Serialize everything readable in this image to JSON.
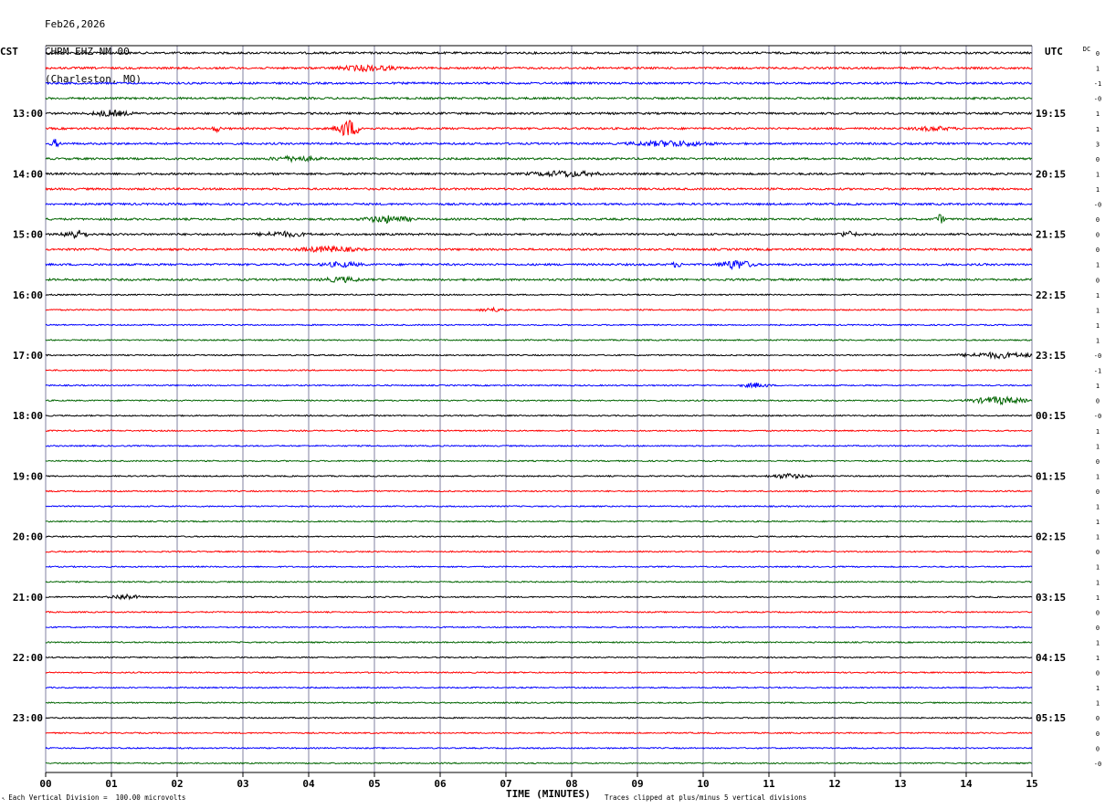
{
  "header": {
    "date": "Feb26,2026",
    "station": "CHRM EHZ NM 00",
    "location": "(Charleston, MO)"
  },
  "left_zone": "CST",
  "right_zone": "UTC",
  "dc_header": "DC",
  "colors": {
    "trace_cycle": [
      "#000000",
      "#ff0000",
      "#0000ff",
      "#006400"
    ],
    "grid": "#8080a0"
  },
  "footer": {
    "left": "Each Vertical Division =  100.00 microvolts",
    "right": "Traces clipped at plus/minus 5 vertical divisions"
  },
  "chart_data": {
    "type": "line",
    "title": "",
    "xlabel": "TIME (MINUTES)",
    "xlim": [
      0,
      15
    ],
    "x_ticks": [
      "00",
      "01",
      "02",
      "03",
      "04",
      "05",
      "06",
      "07",
      "08",
      "09",
      "10",
      "11",
      "12",
      "13",
      "14",
      "15"
    ],
    "rows": 48,
    "rows_per_hour": 4,
    "left_hour_labels": [
      "13:00",
      "14:00",
      "15:00",
      "16:00",
      "17:00",
      "18:00",
      "19:00",
      "20:00",
      "21:00",
      "22:00",
      "23:00"
    ],
    "right_hour_labels": [
      "19:15",
      "20:15",
      "21:15",
      "22:15",
      "23:15",
      "00:15",
      "01:15",
      "02:15",
      "03:15",
      "04:15",
      "05:15"
    ],
    "dc_offsets": [
      "0",
      "1",
      "-1",
      "-0",
      "1",
      "1",
      "3",
      "0",
      "1",
      "1",
      "-0",
      "0",
      "0",
      "0",
      "1",
      "0",
      "1",
      "1",
      "1",
      "1",
      "-0",
      "-1",
      "1",
      "0",
      "-0",
      "1",
      "1",
      "0",
      "1",
      "0",
      "1",
      "1",
      "1",
      "0",
      "1",
      "1",
      "1",
      "0",
      "0",
      "1",
      "1",
      "0",
      "1",
      "1",
      "0",
      "0",
      "0",
      "-0"
    ],
    "events": [
      {
        "row": 1,
        "minute": 4.9,
        "amp": 3.0,
        "dur": 0.6
      },
      {
        "row": 4,
        "minute": 1.0,
        "amp": 3.0,
        "dur": 0.4
      },
      {
        "row": 5,
        "minute": 2.6,
        "amp": 3.0,
        "dur": 0.1
      },
      {
        "row": 5,
        "minute": 4.6,
        "amp": 10.0,
        "dur": 0.25
      },
      {
        "row": 5,
        "minute": 13.5,
        "amp": 2.0,
        "dur": 0.4
      },
      {
        "row": 6,
        "minute": 0.15,
        "amp": 4.0,
        "dur": 0.1
      },
      {
        "row": 6,
        "minute": 9.5,
        "amp": 3.0,
        "dur": 0.8
      },
      {
        "row": 7,
        "minute": 3.8,
        "amp": 2.5,
        "dur": 0.5
      },
      {
        "row": 8,
        "minute": 7.9,
        "amp": 3.0,
        "dur": 0.7
      },
      {
        "row": 11,
        "minute": 5.2,
        "amp": 3.5,
        "dur": 0.5
      },
      {
        "row": 11,
        "minute": 13.6,
        "amp": 5.0,
        "dur": 0.1
      },
      {
        "row": 12,
        "minute": 0.45,
        "amp": 5.0,
        "dur": 0.25
      },
      {
        "row": 12,
        "minute": 3.6,
        "amp": 2.5,
        "dur": 0.5
      },
      {
        "row": 12,
        "minute": 12.2,
        "amp": 3.0,
        "dur": 0.2
      },
      {
        "row": 13,
        "minute": 4.3,
        "amp": 3.0,
        "dur": 0.6
      },
      {
        "row": 14,
        "minute": 4.5,
        "amp": 2.5,
        "dur": 0.4
      },
      {
        "row": 14,
        "minute": 10.5,
        "amp": 5.0,
        "dur": 0.35
      },
      {
        "row": 14,
        "minute": 9.6,
        "amp": 3.0,
        "dur": 0.1
      },
      {
        "row": 15,
        "minute": 4.5,
        "amp": 2.5,
        "dur": 0.4
      },
      {
        "row": 22,
        "minute": 10.8,
        "amp": 2.5,
        "dur": 0.3
      },
      {
        "row": 23,
        "minute": 14.5,
        "amp": 4.0,
        "dur": 0.6
      },
      {
        "row": 20,
        "minute": 14.5,
        "amp": 3.0,
        "dur": 0.8
      },
      {
        "row": 28,
        "minute": 11.3,
        "amp": 2.5,
        "dur": 0.4
      },
      {
        "row": 36,
        "minute": 1.2,
        "amp": 3.0,
        "dur": 0.3
      },
      {
        "row": 17,
        "minute": 6.8,
        "amp": 2.0,
        "dur": 0.3
      }
    ]
  }
}
